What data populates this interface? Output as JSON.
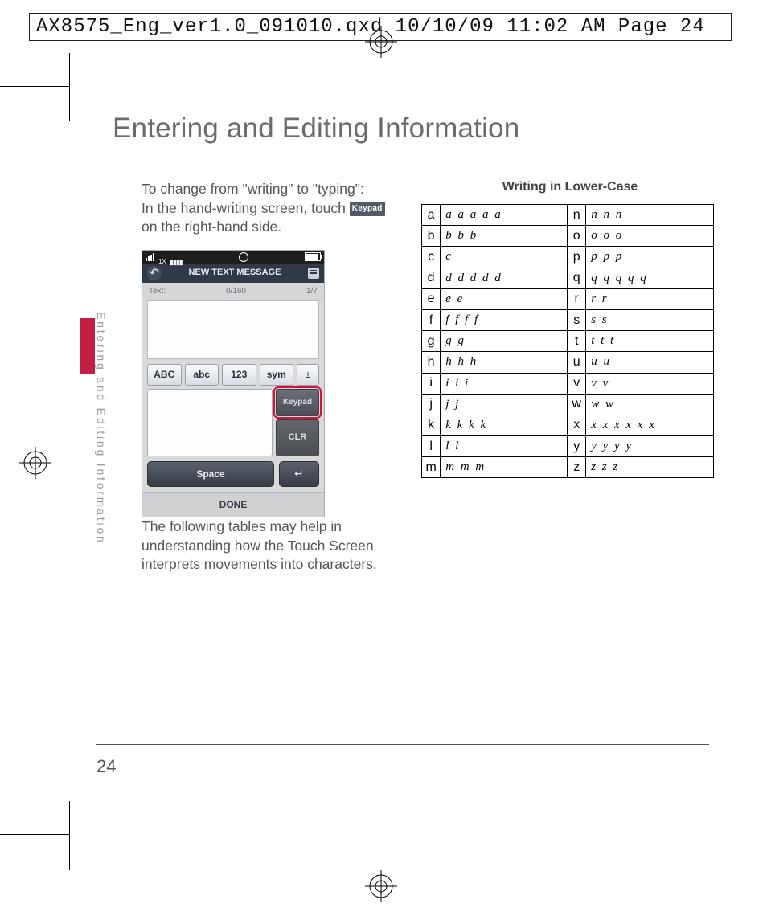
{
  "header_line": "AX8575_Eng_ver1.0_091010.qxd  10/10/09  11:02 AM  Page 24",
  "title": "Entering and Editing Information",
  "side_tab": "Entering and Editing Information",
  "page_number": "24",
  "left": {
    "p1a": "To change from \"writing\" to \"typing\":",
    "p1b": "In the hand-writing screen, touch",
    "p1c": " on the right-hand side.",
    "keypad_inline": "Keypad",
    "p2": "The following tables may help in understanding how the Touch Screen interprets movements into characters."
  },
  "phone": {
    "title": "NEW TEXT MESSAGE",
    "text_label": "Text:",
    "counter": "0/160",
    "page": "1/7",
    "modes": [
      "ABC",
      "abc",
      "123",
      "sym"
    ],
    "eject": "±",
    "keypad": "Keypad",
    "clr": "CLR",
    "space": "Space",
    "enter": "↵",
    "done": "DONE"
  },
  "right": {
    "heading": "Writing in Lower-Case",
    "rows": [
      {
        "l1": "a",
        "s1": "a a a a a",
        "l2": "n",
        "s2": "n n n"
      },
      {
        "l1": "b",
        "s1": "b b b",
        "l2": "o",
        "s2": "o o o"
      },
      {
        "l1": "c",
        "s1": "c",
        "l2": "p",
        "s2": "p p p"
      },
      {
        "l1": "d",
        "s1": "d d d d d",
        "l2": "q",
        "s2": "q q q q q"
      },
      {
        "l1": "e",
        "s1": "e e",
        "l2": "r",
        "s2": "r r"
      },
      {
        "l1": "f",
        "s1": "f f f f",
        "l2": "s",
        "s2": "s s"
      },
      {
        "l1": "g",
        "s1": "g g",
        "l2": "t",
        "s2": "t t t"
      },
      {
        "l1": "h",
        "s1": "h h h",
        "l2": "u",
        "s2": "u u"
      },
      {
        "l1": "i",
        "s1": "i i i",
        "l2": "v",
        "s2": "v v"
      },
      {
        "l1": "j",
        "s1": "j j",
        "l2": "w",
        "s2": "w w"
      },
      {
        "l1": "k",
        "s1": "k k k k",
        "l2": "x",
        "s2": "x x x x x x"
      },
      {
        "l1": "l",
        "s1": "l l",
        "l2": "y",
        "s2": "y y y y"
      },
      {
        "l1": "m",
        "s1": "m m m",
        "l2": "z",
        "s2": "z z z"
      }
    ]
  }
}
